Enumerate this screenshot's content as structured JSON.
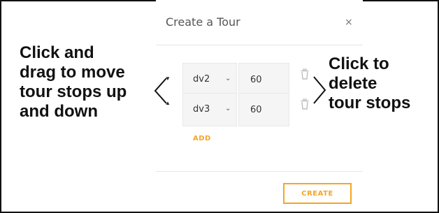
{
  "dialog": {
    "title": "Create a Tour",
    "close_symbol": "×"
  },
  "stops": [
    {
      "drag_icon": "drag-down-arrow",
      "view": "dv2",
      "duration": "60"
    },
    {
      "drag_icon": "drag-up-arrow",
      "view": "dv3",
      "duration": "60"
    }
  ],
  "buttons": {
    "add_label": "ADD",
    "create_label": "CREATE"
  },
  "annotations": {
    "left": [
      "Click and",
      "drag to move",
      "tour stops up",
      "and down"
    ],
    "right": [
      "Click to",
      "delete",
      "tour stops"
    ]
  },
  "colors": {
    "accent": "#f5a623",
    "border": "#111111",
    "field_bg": "#f5f5f5"
  }
}
